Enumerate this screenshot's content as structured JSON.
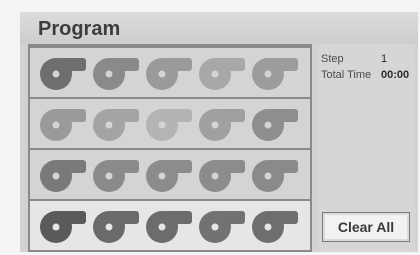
{
  "window": {
    "title": "Program"
  },
  "info": {
    "step_label": "Step",
    "step_value": "1",
    "total_time_label": "Total Time",
    "total_time_value": "00:00"
  },
  "buttons": {
    "clear_all_label": "Clear All"
  },
  "program_grid": {
    "rows": 4,
    "columns": 5,
    "slot_icon": "disc-icon"
  }
}
